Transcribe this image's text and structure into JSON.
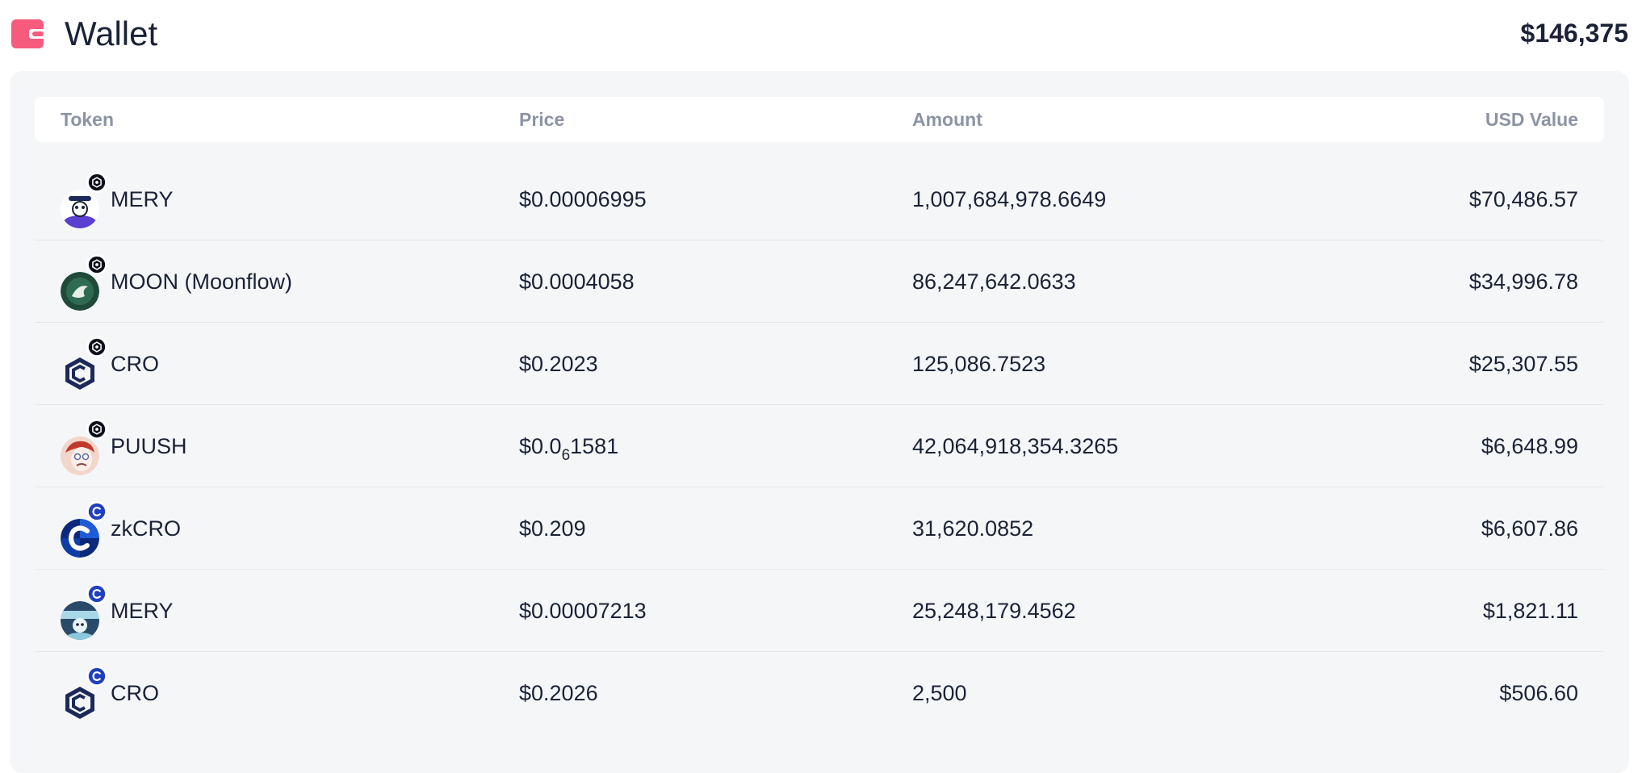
{
  "header": {
    "title": "Wallet",
    "total": "$146,375",
    "icon": "wallet-icon"
  },
  "table": {
    "columns": {
      "token": "Token",
      "price": "Price",
      "amount": "Amount",
      "usd": "USD Value"
    },
    "rows": [
      {
        "token": "MERY",
        "price_prefix": "$0.00006995",
        "price_sub": "",
        "price_suffix": "",
        "amount": "1,007,684,978.6649",
        "usd": "$70,486.57",
        "avatar": "mery-mascot-icon",
        "badge": "cronos-chain-badge"
      },
      {
        "token": "MOON (Moonflow)",
        "price_prefix": "$0.0004058",
        "price_sub": "",
        "price_suffix": "",
        "amount": "86,247,642.0633",
        "usd": "$34,996.78",
        "avatar": "moonflow-icon",
        "badge": "cronos-chain-badge"
      },
      {
        "token": "CRO",
        "price_prefix": "$0.2023",
        "price_sub": "",
        "price_suffix": "",
        "amount": "125,086.7523",
        "usd": "$25,307.55",
        "avatar": "cro-icon",
        "badge": "cronos-chain-badge"
      },
      {
        "token": "PUUSH",
        "price_prefix": "$0.0",
        "price_sub": "6",
        "price_suffix": "1581",
        "amount": "42,064,918,354.3265",
        "usd": "$6,648.99",
        "avatar": "puush-face-icon",
        "badge": "cronos-chain-badge"
      },
      {
        "token": "zkCRO",
        "price_prefix": "$0.209",
        "price_sub": "",
        "price_suffix": "",
        "amount": "31,620.0852",
        "usd": "$6,607.86",
        "avatar": "zkcro-icon",
        "badge": "cronos-zkevm-badge"
      },
      {
        "token": "MERY",
        "price_prefix": "$0.00007213",
        "price_sub": "",
        "price_suffix": "",
        "amount": "25,248,179.4562",
        "usd": "$1,821.11",
        "avatar": "mery-round-icon",
        "badge": "cronos-zkevm-badge"
      },
      {
        "token": "CRO",
        "price_prefix": "$0.2026",
        "price_sub": "",
        "price_suffix": "",
        "amount": "2,500",
        "usd": "$506.60",
        "avatar": "cro-icon",
        "badge": "cronos-zkevm-badge"
      }
    ]
  },
  "colors": {
    "wallet_icon": "#f65b7e",
    "text": "#1b2236",
    "muted": "#8c93a4",
    "panel": "#f5f6f8",
    "cro_navy": "#1c2a5a",
    "zk_blue": "#1f5bd6"
  }
}
